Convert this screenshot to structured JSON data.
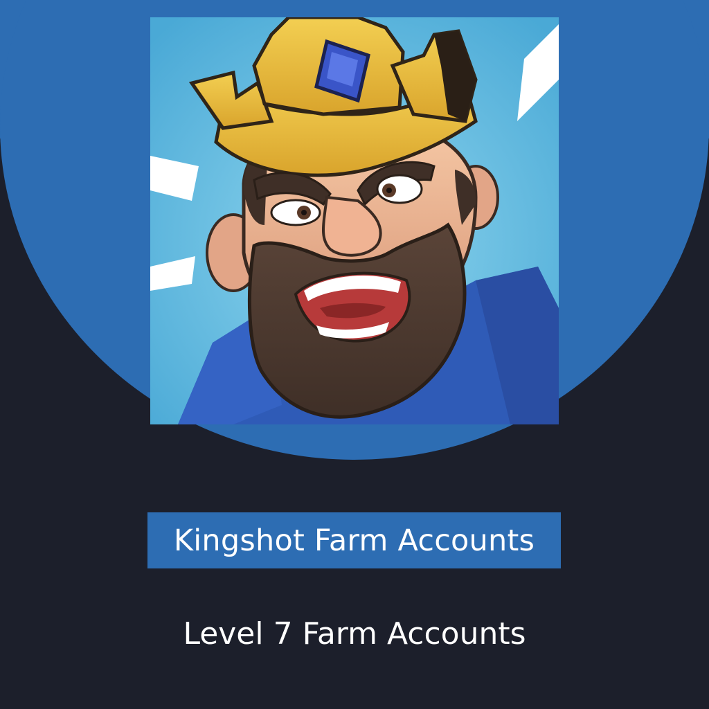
{
  "product": {
    "image_icon": "king-portrait-icon",
    "title": "Kingshot Farm Accounts",
    "subtitle": "Level 7 Farm Accounts"
  },
  "colors": {
    "background": "#1c1f2b",
    "accent_blue": "#2d6db3",
    "sky": "#56b6dc",
    "crown_gold": "#e8b73a",
    "gem_blue": "#3a55c8",
    "text": "#ffffff"
  }
}
